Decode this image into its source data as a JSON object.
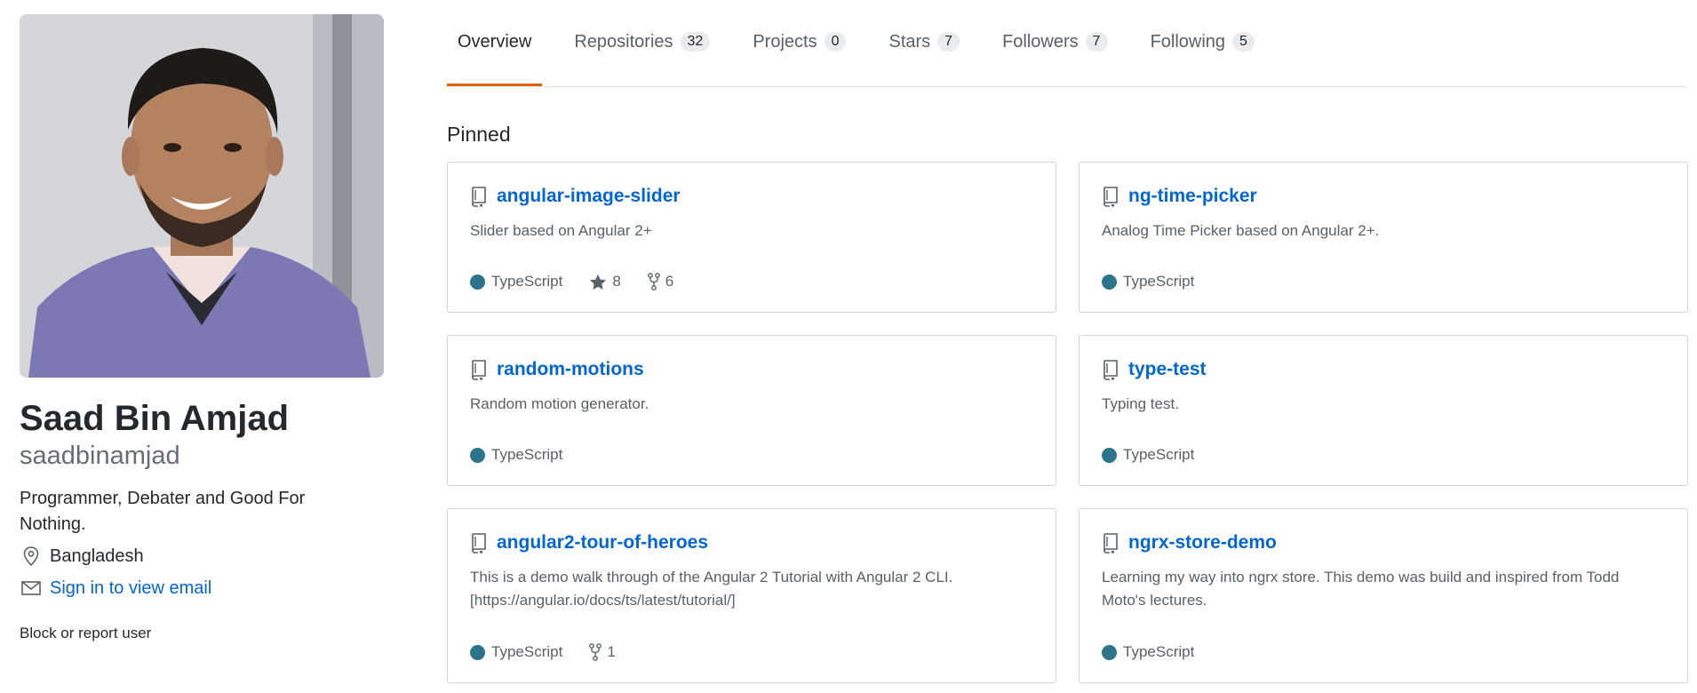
{
  "profile": {
    "full_name": "Saad Bin Amjad",
    "username": "saadbinamjad",
    "bio": "Programmer, Debater and Good For Nothing.",
    "location": "Bangladesh",
    "email_link": "Sign in to view email",
    "block_link": "Block or report user"
  },
  "tabs": [
    {
      "label": "Overview",
      "count": null,
      "active": true
    },
    {
      "label": "Repositories",
      "count": "32"
    },
    {
      "label": "Projects",
      "count": "0"
    },
    {
      "label": "Stars",
      "count": "7"
    },
    {
      "label": "Followers",
      "count": "7"
    },
    {
      "label": "Following",
      "count": "5"
    }
  ],
  "pinned": {
    "heading": "Pinned",
    "repos": [
      {
        "name": "angular-image-slider",
        "description": "Slider based on Angular 2+",
        "language": "TypeScript",
        "stars": "8",
        "forks": "6"
      },
      {
        "name": "ng-time-picker",
        "description": "Analog Time Picker based on Angular 2+.",
        "language": "TypeScript"
      },
      {
        "name": "random-motions",
        "description": "Random motion generator.",
        "language": "TypeScript"
      },
      {
        "name": "type-test",
        "description": "Typing test.",
        "language": "TypeScript"
      },
      {
        "name": "angular2-tour-of-heroes",
        "description": "This is a demo walk through of the Angular 2 Tutorial with Angular 2 CLI. [https://angular.io/docs/ts/latest/tutorial/]",
        "language": "TypeScript",
        "forks": "1"
      },
      {
        "name": "ngrx-store-demo",
        "description": "Learning my way into ngrx store. This demo was build and inspired from Todd Moto's lectures.",
        "language": "TypeScript"
      }
    ]
  },
  "colors": {
    "accent_tab": "#e36209",
    "link": "#0366d6",
    "typescript": "#2b7489"
  },
  "icons": {
    "location": "location-pin-icon",
    "email": "mail-icon",
    "repo": "repo-book-icon",
    "star": "star-icon",
    "fork": "fork-icon"
  }
}
